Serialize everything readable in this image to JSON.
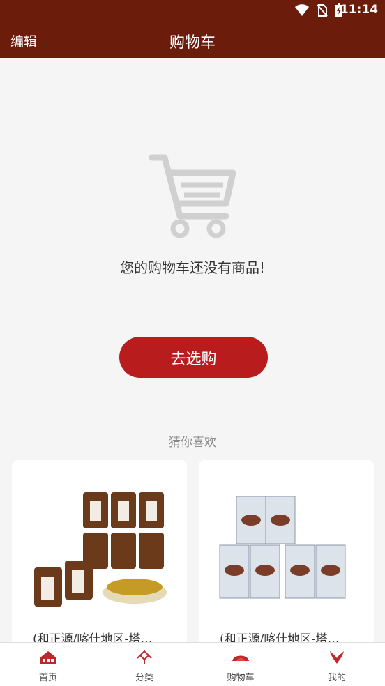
{
  "status": {
    "time": "11:14"
  },
  "header": {
    "edit_label": "编辑",
    "title": "购物车"
  },
  "empty": {
    "message": "您的购物车还没有商品!",
    "button_label": "去选购"
  },
  "recommend": {
    "heading": "猜你喜欢",
    "products": [
      {
        "title": "(和正源/喀什地区-塔…"
      },
      {
        "title": "(和正源/喀什地区-塔…"
      }
    ]
  },
  "tabs": [
    {
      "label": "首页"
    },
    {
      "label": "分类"
    },
    {
      "label": "购物车"
    },
    {
      "label": "我的"
    }
  ],
  "colors": {
    "brand": "#6c1c0b",
    "button": "#b81c1c"
  }
}
